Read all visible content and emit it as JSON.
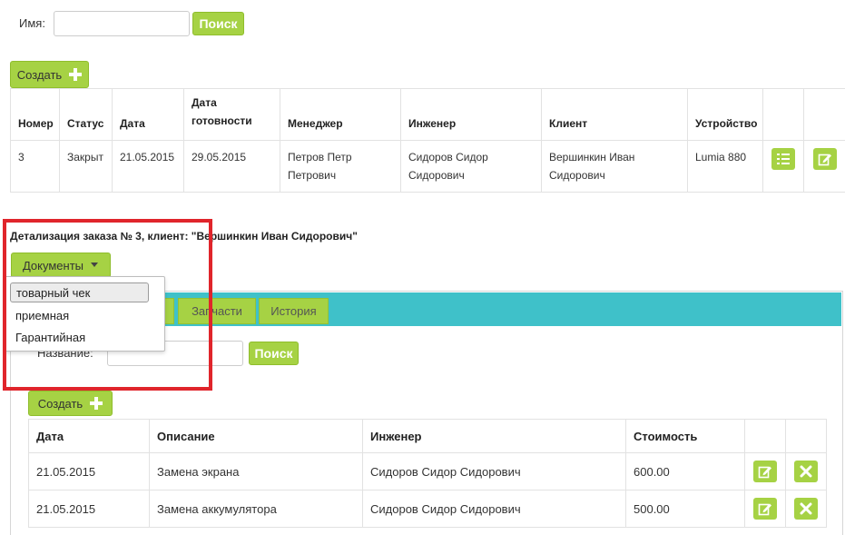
{
  "search": {
    "label": "Имя:",
    "value": "",
    "button": "Поиск"
  },
  "create_button": "Создать",
  "orders": {
    "headers": [
      "Номер",
      "Статус",
      "Дата",
      "Дата готовности",
      "Менеджер",
      "Инженер",
      "Клиент",
      "Устройство"
    ],
    "rows": [
      {
        "num": "3",
        "status": "Закрыт",
        "date": "21.05.2015",
        "ready": "29.05.2015",
        "manager": "Петров Петр Петрович",
        "engineer": "Сидоров Сидор Сидорович",
        "client": "Вершинкин Иван Сидорович",
        "device": "Lumia 880"
      }
    ]
  },
  "detail": {
    "title": "Детализация заказа № 3, клиент: \"Вершинкин Иван Сидорович\"",
    "docs_button": "Документы",
    "docs_menu": [
      "товарный чек",
      "приемная",
      "Гарантийная"
    ],
    "tabs": [
      "Запчасти",
      "История"
    ],
    "search_label": "Название:",
    "search_value": "",
    "search_button": "Поиск",
    "create_button": "Создать",
    "works": {
      "headers": [
        "Дата",
        "Описание",
        "Инженер",
        "Стоимость"
      ],
      "rows": [
        {
          "date": "21.05.2015",
          "desc": "Замена экрана",
          "engineer": "Сидоров Сидор Сидорович",
          "cost": "600.00"
        },
        {
          "date": "21.05.2015",
          "desc": "Замена аккумулятора",
          "engineer": "Сидоров Сидор Сидорович",
          "cost": "500.00"
        }
      ]
    }
  },
  "colors": {
    "accent_green": "#a6d244",
    "tab_bar": "#3fc1c9",
    "highlight_box": "#e0252b"
  },
  "icons": [
    "list-icon",
    "edit-icon",
    "delete-icon",
    "caret-down-icon",
    "plus-icon"
  ]
}
